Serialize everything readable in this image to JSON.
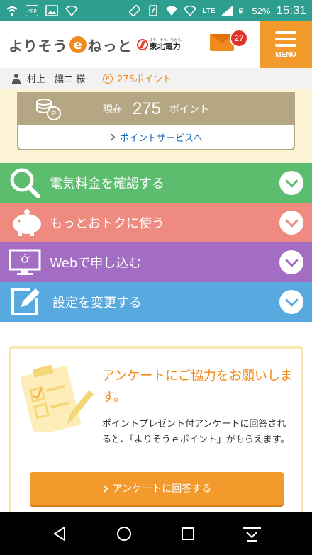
{
  "status_bar": {
    "battery_percent": "52%",
    "network": "LTE",
    "time": "15:31",
    "app_badge": "App"
  },
  "header": {
    "logo_prefix": "よりそう",
    "logo_e": "e",
    "logo_suffix": "ねっと",
    "partner_tagline": "より、そう、ちから。",
    "partner_name": "東北電力",
    "mail_badge_count": "27",
    "menu_label": "MENU"
  },
  "user_bar": {
    "user_name": "村上　讓二 様",
    "points_icon": "P",
    "points_text": "275ポイント"
  },
  "point_card": {
    "label": "現在",
    "value": "275",
    "unit": "ポイント",
    "link_label": "ポイントサービスへ"
  },
  "menu": {
    "items": [
      {
        "label": "電気料金を確認する",
        "icon": "magnifier-icon",
        "color": "#5dbd6f"
      },
      {
        "label": "もっとおトクに使う",
        "icon": "piggy-bank-icon",
        "color": "#ef8a80"
      },
      {
        "label": "Webで申し込む",
        "icon": "monitor-icon",
        "color": "#a46dc4"
      },
      {
        "label": "設定を変更する",
        "icon": "edit-icon",
        "color": "#58a9df"
      }
    ]
  },
  "survey": {
    "title": "アンケートにご協力をお願いします。",
    "body": "ポイントプレゼント付アンケートに回答されると、「よりそうｅポイント」がもらえます。",
    "button_label": "アンケートに回答する"
  },
  "colors": {
    "status_bar": "#2e9f8f",
    "accent": "#f39a2d",
    "point_card": "#b5a784"
  }
}
